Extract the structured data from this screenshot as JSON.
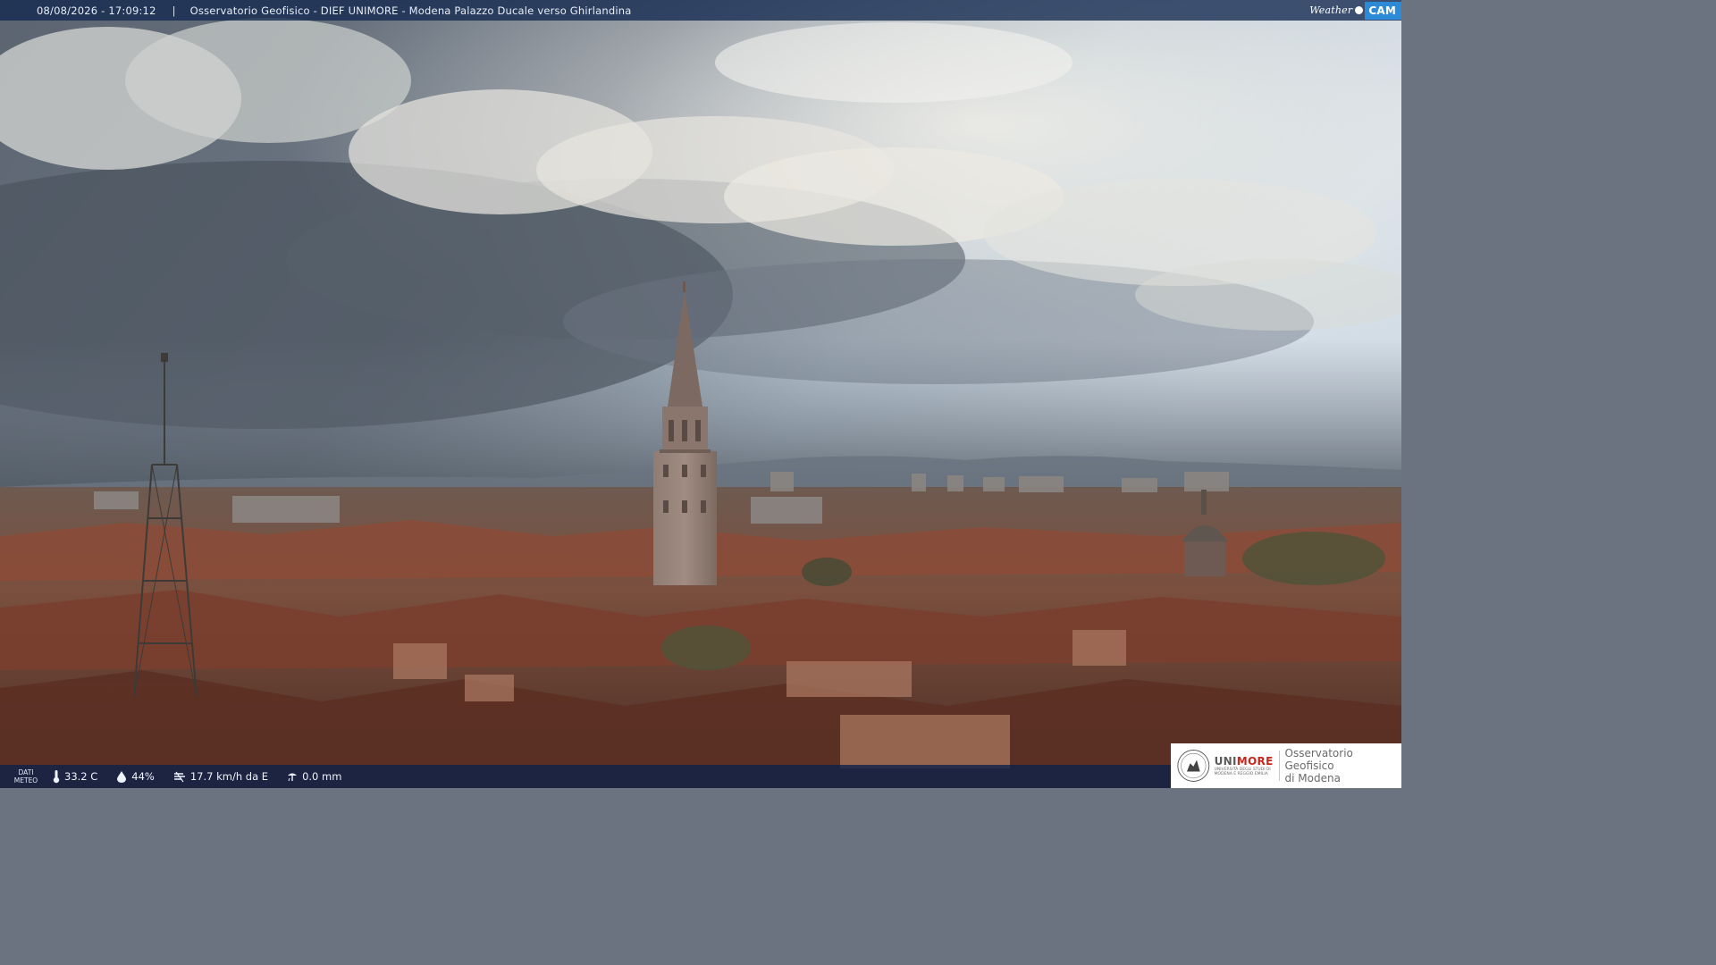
{
  "header": {
    "datetime": "08/08/2026 - 17:09:12",
    "separator": "|",
    "title": "Osservatorio Geofisico - DIEF UNIMORE - Modena Palazzo Ducale verso Ghirlandina",
    "logo_weather": "Weather",
    "logo_cam": "CAM"
  },
  "weather_bar": {
    "label_line1": "DATI",
    "label_line2": "METEO",
    "temperature": "33.2 C",
    "humidity": "44%",
    "wind": "17.7 km/h da E",
    "rain": "0.0 mm",
    "icons": [
      "thermometer-icon",
      "humidity-drop-icon",
      "wind-icon",
      "rain-icon"
    ]
  },
  "institution": {
    "brand_prefix": "UNI",
    "brand_suffix": "MORE",
    "brand_sub_line1": "UNIVERSITÀ DEGLI STUDI DI",
    "brand_sub_line2": "MODENA E REGGIO EMILIA",
    "observatory_line1": "Osservatorio Geofisico",
    "observatory_line2": "di Modena"
  },
  "colors": {
    "bar_bg": "#12284e",
    "accent_red": "#c9261e",
    "cam_blue": "#2d8ad6"
  }
}
